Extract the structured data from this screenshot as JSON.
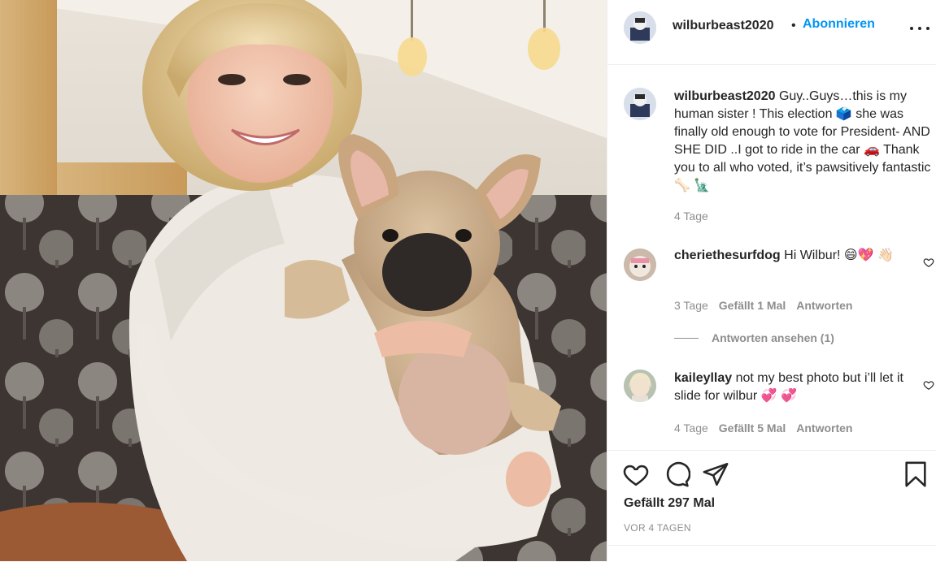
{
  "post": {
    "image_alt": "young woman holding a french bulldog",
    "header": {
      "username": "wilburbeast2020",
      "separator": "•",
      "follow_label": "Abonnieren",
      "more_icon": "more-options-icon"
    },
    "caption": {
      "username": "wilburbeast2020",
      "text": " Guy..Guys…this is my human sister ! This election 🗳️ she was finally old enough to vote for President- AND SHE DID ..I got to ride in the car 🚗 Thank you to all who voted, it’s pawsitively fantastic 🦴 🗽",
      "time": "4 Tage"
    },
    "comments": [
      {
        "username": "cheriethesurfdog",
        "text": " Hi Wilbur! 😄💖 👋🏻",
        "time": "3 Tage",
        "likes": "Gefällt 1 Mal",
        "reply": "Antworten",
        "view_replies": "Antworten ansehen (1)"
      },
      {
        "username": "kaileyllay",
        "text": " not my best photo but i’ll let it slide for wilbur 💞 💞",
        "time": "4 Tage",
        "likes": "Gefällt 5 Mal",
        "reply": "Antworten"
      }
    ],
    "footer": {
      "likes": "Gefällt 297 Mal",
      "time_ago": "VOR 4 TAGEN"
    }
  },
  "colors": {
    "accent": "#0095f6",
    "text": "#262626",
    "muted": "#8e8e8e",
    "border": "#efefef"
  }
}
